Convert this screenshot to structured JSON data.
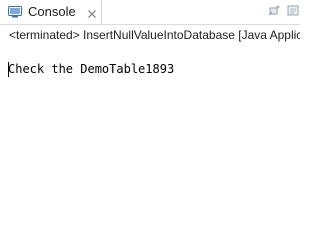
{
  "console_tab": {
    "label": "Console",
    "close_glyph": "✕"
  },
  "status_line": "<terminated> InsertNullValueIntoDatabase [Java Application]",
  "console_output": "Check the DemoTable1893",
  "icons": {
    "tab": "console-monitor-icon",
    "close": "close-icon",
    "toolbar": [
      "pin-console-icon",
      "remove-terminated-icon"
    ]
  },
  "colors": {
    "tab_border": "#cfd7e2",
    "icon_blue": "#3b6fb6",
    "icon_gray": "#9aa3ad"
  }
}
